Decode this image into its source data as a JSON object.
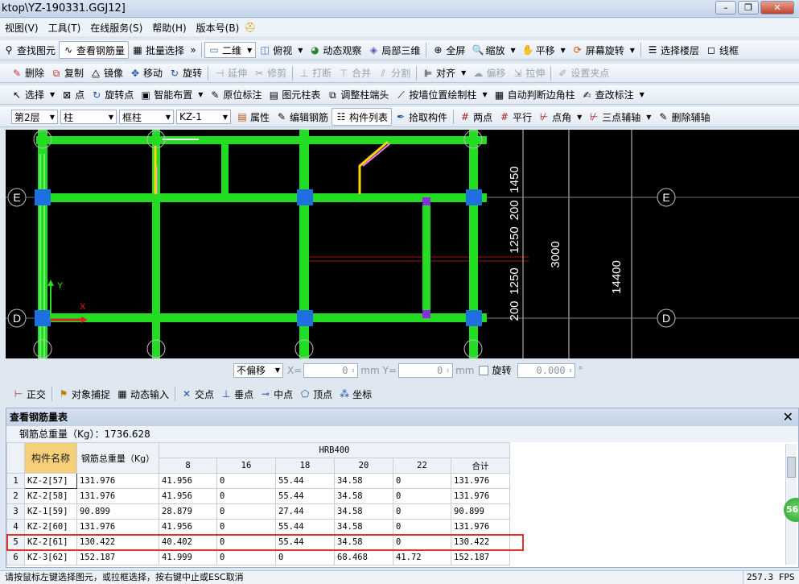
{
  "title": "ktop\\YZ-190331.GGJ12]",
  "menu": [
    "视图(V)",
    "工具(T)",
    "在线服务(S)",
    "帮助(H)",
    "版本号(B)"
  ],
  "toolbar1": {
    "find": "查找图元",
    "view_rebar": "查看钢筋量",
    "batch": "批量选择",
    "mode": "二维",
    "top_view": "俯视",
    "dynamic": "动态观察",
    "local3d": "局部三维",
    "fullscreen": "全屏",
    "zoom": "缩放",
    "pan": "平移",
    "screen_rotate": "屏幕旋转",
    "select_floor": "选择楼层",
    "wireframe": "线框"
  },
  "toolbar2": {
    "delete": "删除",
    "copy": "复制",
    "mirror": "镜像",
    "move": "移动",
    "rotate": "旋转",
    "extend": "延伸",
    "trim": "修剪",
    "break": "打断",
    "merge": "合并",
    "split": "分割",
    "align": "对齐",
    "offset": "偏移",
    "stretch": "拉伸",
    "set_point": "设置夹点"
  },
  "toolbar3": {
    "select": "选择",
    "point": "点",
    "rotate_point": "旋转点",
    "smart_layout": "智能布置",
    "orig_annot": "原位标注",
    "elem_table": "图元柱表",
    "adjust_end": "调整柱端头",
    "wall_draw": "按墙位置绘制柱",
    "auto_corner": "自动判断边角柱",
    "modify_annot": "查改标注"
  },
  "toolbar4": {
    "floor": "第2层",
    "type": "柱",
    "subtype": "框柱",
    "name": "KZ-1",
    "props": "属性",
    "edit_rebar": "编辑钢筋",
    "comp_list": "构件列表",
    "pick": "拾取构件",
    "two_point": "两点",
    "parallel": "平行",
    "point_angle": "点角",
    "three_point": "三点辅轴",
    "del_axis": "删除辅轴"
  },
  "canvas": {
    "axis_E": "E",
    "axis_D": "D",
    "dim_1450": "1450",
    "dim_200": "200",
    "dim_1250a": "1250",
    "dim_1250b": "1250",
    "dim_200b": "200",
    "dim_3000": "3000",
    "dim_14400": "14400",
    "dim_top": "1450",
    "axis_x": "X",
    "axis_y": "Y"
  },
  "inputbar": {
    "offset": "不偏移",
    "x_label": "X=",
    "x_val": "0",
    "unit1": "mm",
    "y_label": "Y=",
    "y_val": "0",
    "unit2": "mm",
    "rotate": "旋转",
    "rot_val": "0.000",
    "deg": "°"
  },
  "snapbar": {
    "ortho": "正交",
    "snap": "对象捕捉",
    "dyn_input": "动态输入",
    "intersect": "交点",
    "perp": "垂点",
    "mid": "中点",
    "vertex": "顶点",
    "coord": "坐标"
  },
  "panel": {
    "title": "查看钢筋量表",
    "total": "钢筋总重量（Kg）：1736.628",
    "col_name": "构件名称",
    "col_weight": "钢筋总重量（Kg）",
    "grade": "HRB400",
    "sub_cols": [
      "8",
      "16",
      "18",
      "20",
      "22",
      "合计"
    ],
    "rows": [
      {
        "n": "1",
        "name": "KZ-2[57]",
        "w": "131.976",
        "c8": "41.956",
        "c16": "0",
        "c18": "55.44",
        "c20": "34.58",
        "c22": "0",
        "sum": "131.976"
      },
      {
        "n": "2",
        "name": "KZ-2[58]",
        "w": "131.976",
        "c8": "41.956",
        "c16": "0",
        "c18": "55.44",
        "c20": "34.58",
        "c22": "0",
        "sum": "131.976"
      },
      {
        "n": "3",
        "name": "KZ-1[59]",
        "w": "90.899",
        "c8": "28.879",
        "c16": "0",
        "c18": "27.44",
        "c20": "34.58",
        "c22": "0",
        "sum": "90.899"
      },
      {
        "n": "4",
        "name": "KZ-2[60]",
        "w": "131.976",
        "c8": "41.956",
        "c16": "0",
        "c18": "55.44",
        "c20": "34.58",
        "c22": "0",
        "sum": "131.976"
      },
      {
        "n": "5",
        "name": "KZ-2[61]",
        "w": "130.422",
        "c8": "40.402",
        "c16": "0",
        "c18": "55.44",
        "c20": "34.58",
        "c22": "0",
        "sum": "130.422"
      },
      {
        "n": "6",
        "name": "KZ-3[62]",
        "w": "152.187",
        "c8": "41.999",
        "c16": "0",
        "c18": "0",
        "c20": "68.468",
        "c22": "41.72",
        "sum": "152.187"
      }
    ]
  },
  "badge": "56",
  "status": {
    "message": "请按鼠标左键选择图元，或拉框选择，按右键中止或ESC取消",
    "fps": "257.3 FPS"
  },
  "colors": {
    "beam": "#22dd22",
    "column": "#1e6fe0",
    "highlight": "#e03030",
    "canvas_bg": "#000000"
  }
}
